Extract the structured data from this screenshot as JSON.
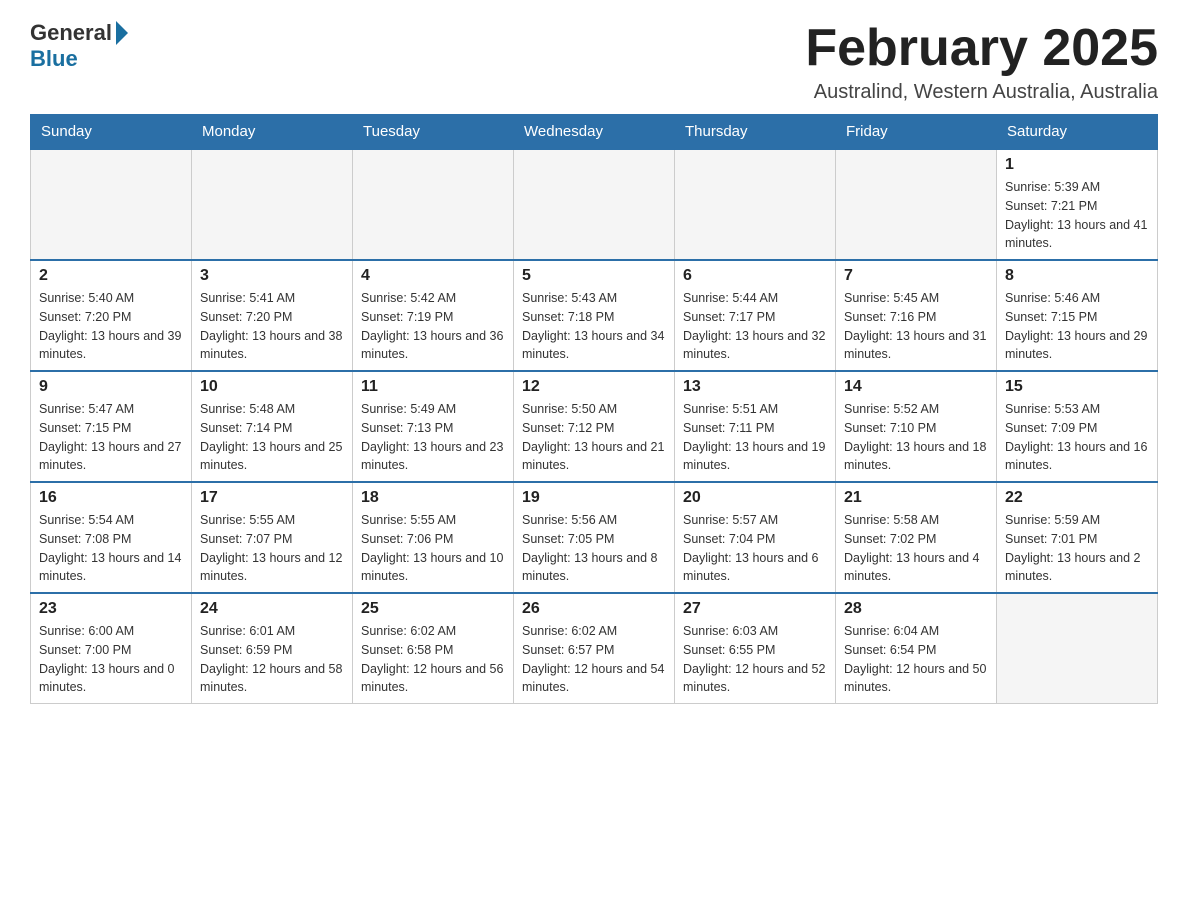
{
  "header": {
    "logo_general": "General",
    "logo_blue": "Blue",
    "month_title": "February 2025",
    "location": "Australind, Western Australia, Australia"
  },
  "days_of_week": [
    "Sunday",
    "Monday",
    "Tuesday",
    "Wednesday",
    "Thursday",
    "Friday",
    "Saturday"
  ],
  "weeks": [
    [
      {
        "day": "",
        "info": ""
      },
      {
        "day": "",
        "info": ""
      },
      {
        "day": "",
        "info": ""
      },
      {
        "day": "",
        "info": ""
      },
      {
        "day": "",
        "info": ""
      },
      {
        "day": "",
        "info": ""
      },
      {
        "day": "1",
        "info": "Sunrise: 5:39 AM\nSunset: 7:21 PM\nDaylight: 13 hours and 41 minutes."
      }
    ],
    [
      {
        "day": "2",
        "info": "Sunrise: 5:40 AM\nSunset: 7:20 PM\nDaylight: 13 hours and 39 minutes."
      },
      {
        "day": "3",
        "info": "Sunrise: 5:41 AM\nSunset: 7:20 PM\nDaylight: 13 hours and 38 minutes."
      },
      {
        "day": "4",
        "info": "Sunrise: 5:42 AM\nSunset: 7:19 PM\nDaylight: 13 hours and 36 minutes."
      },
      {
        "day": "5",
        "info": "Sunrise: 5:43 AM\nSunset: 7:18 PM\nDaylight: 13 hours and 34 minutes."
      },
      {
        "day": "6",
        "info": "Sunrise: 5:44 AM\nSunset: 7:17 PM\nDaylight: 13 hours and 32 minutes."
      },
      {
        "day": "7",
        "info": "Sunrise: 5:45 AM\nSunset: 7:16 PM\nDaylight: 13 hours and 31 minutes."
      },
      {
        "day": "8",
        "info": "Sunrise: 5:46 AM\nSunset: 7:15 PM\nDaylight: 13 hours and 29 minutes."
      }
    ],
    [
      {
        "day": "9",
        "info": "Sunrise: 5:47 AM\nSunset: 7:15 PM\nDaylight: 13 hours and 27 minutes."
      },
      {
        "day": "10",
        "info": "Sunrise: 5:48 AM\nSunset: 7:14 PM\nDaylight: 13 hours and 25 minutes."
      },
      {
        "day": "11",
        "info": "Sunrise: 5:49 AM\nSunset: 7:13 PM\nDaylight: 13 hours and 23 minutes."
      },
      {
        "day": "12",
        "info": "Sunrise: 5:50 AM\nSunset: 7:12 PM\nDaylight: 13 hours and 21 minutes."
      },
      {
        "day": "13",
        "info": "Sunrise: 5:51 AM\nSunset: 7:11 PM\nDaylight: 13 hours and 19 minutes."
      },
      {
        "day": "14",
        "info": "Sunrise: 5:52 AM\nSunset: 7:10 PM\nDaylight: 13 hours and 18 minutes."
      },
      {
        "day": "15",
        "info": "Sunrise: 5:53 AM\nSunset: 7:09 PM\nDaylight: 13 hours and 16 minutes."
      }
    ],
    [
      {
        "day": "16",
        "info": "Sunrise: 5:54 AM\nSunset: 7:08 PM\nDaylight: 13 hours and 14 minutes."
      },
      {
        "day": "17",
        "info": "Sunrise: 5:55 AM\nSunset: 7:07 PM\nDaylight: 13 hours and 12 minutes."
      },
      {
        "day": "18",
        "info": "Sunrise: 5:55 AM\nSunset: 7:06 PM\nDaylight: 13 hours and 10 minutes."
      },
      {
        "day": "19",
        "info": "Sunrise: 5:56 AM\nSunset: 7:05 PM\nDaylight: 13 hours and 8 minutes."
      },
      {
        "day": "20",
        "info": "Sunrise: 5:57 AM\nSunset: 7:04 PM\nDaylight: 13 hours and 6 minutes."
      },
      {
        "day": "21",
        "info": "Sunrise: 5:58 AM\nSunset: 7:02 PM\nDaylight: 13 hours and 4 minutes."
      },
      {
        "day": "22",
        "info": "Sunrise: 5:59 AM\nSunset: 7:01 PM\nDaylight: 13 hours and 2 minutes."
      }
    ],
    [
      {
        "day": "23",
        "info": "Sunrise: 6:00 AM\nSunset: 7:00 PM\nDaylight: 13 hours and 0 minutes."
      },
      {
        "day": "24",
        "info": "Sunrise: 6:01 AM\nSunset: 6:59 PM\nDaylight: 12 hours and 58 minutes."
      },
      {
        "day": "25",
        "info": "Sunrise: 6:02 AM\nSunset: 6:58 PM\nDaylight: 12 hours and 56 minutes."
      },
      {
        "day": "26",
        "info": "Sunrise: 6:02 AM\nSunset: 6:57 PM\nDaylight: 12 hours and 54 minutes."
      },
      {
        "day": "27",
        "info": "Sunrise: 6:03 AM\nSunset: 6:55 PM\nDaylight: 12 hours and 52 minutes."
      },
      {
        "day": "28",
        "info": "Sunrise: 6:04 AM\nSunset: 6:54 PM\nDaylight: 12 hours and 50 minutes."
      },
      {
        "day": "",
        "info": ""
      }
    ]
  ]
}
